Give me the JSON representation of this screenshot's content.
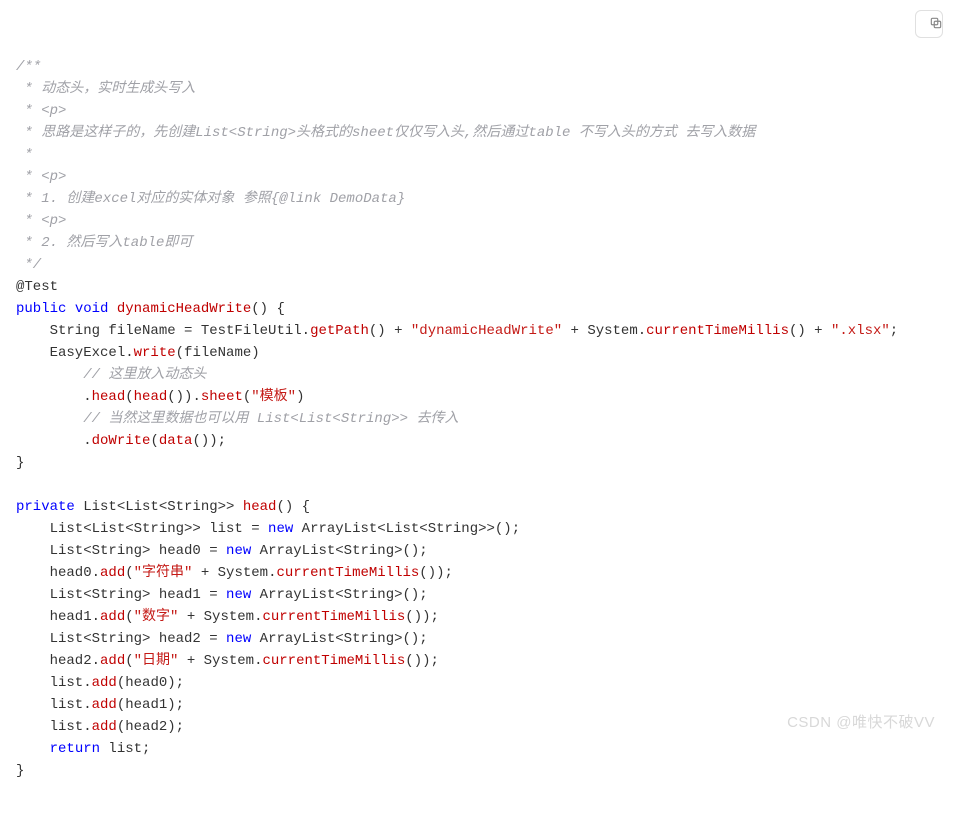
{
  "copy_button_title": "Copy",
  "watermark": "CSDN @唯快不破VV",
  "code": {
    "l01": "/**",
    "l02": " * 动态头，实时生成头写入",
    "l03": " * <p>",
    "l04": " * 思路是这样子的，先创建List<String>头格式的sheet仅仅写入头,然后通过table 不写入头的方式 去写入数据",
    "l05": " *",
    "l06": " * <p>",
    "l07": " * 1. 创建excel对应的实体对象 参照{@link DemoData}",
    "l08": " * <p>",
    "l09": " * 2. 然后写入table即可",
    "l10": " */",
    "l11": "@Test",
    "l12_public": "public",
    "l12_void": " void",
    "l12_name": " dynamicHeadWrite",
    "l12_rest": "() {",
    "l13_a": "    String fileName = TestFileUtil.",
    "l13_getPath": "getPath",
    "l13_b": "() + ",
    "l13_s1": "\"dynamicHeadWrite\"",
    "l13_c": " + System.",
    "l13_ctm": "currentTimeMillis",
    "l13_d": "() + ",
    "l13_s2": "\".xlsx\"",
    "l13_e": ";",
    "l14_a": "    EasyExcel.",
    "l14_write": "write",
    "l14_b": "(fileName)",
    "l15": "        // 这里放入动态头",
    "l16_a": "        .",
    "l16_head": "head",
    "l16_b": "(",
    "l16_headcall": "head",
    "l16_c": "()).",
    "l16_sheet": "sheet",
    "l16_d": "(",
    "l16_s": "\"模板\"",
    "l16_e": ")",
    "l17": "        // 当然这里数据也可以用 List<List<String>> 去传入",
    "l18_a": "        .",
    "l18_doWrite": "doWrite",
    "l18_b": "(",
    "l18_data": "data",
    "l18_c": "());",
    "l19": "}",
    "l20": "",
    "l21_private": "private",
    "l21_type": " List<List<String>>",
    "l21_name": " head",
    "l21_rest": "() {",
    "l22_a": "    List<List<String>> list = ",
    "l22_new": "new",
    "l22_b": " ArrayList<List<String>>();",
    "l23_a": "    List<String> head0 = ",
    "l23_new": "new",
    "l23_b": " ArrayList<String>();",
    "l24_a": "    head0.",
    "l24_add": "add",
    "l24_b": "(",
    "l24_s": "\"字符串\"",
    "l24_c": " + System.",
    "l24_ctm": "currentTimeMillis",
    "l24_d": "());",
    "l25_a": "    List<String> head1 = ",
    "l25_new": "new",
    "l25_b": " ArrayList<String>();",
    "l26_a": "    head1.",
    "l26_add": "add",
    "l26_b": "(",
    "l26_s": "\"数字\"",
    "l26_c": " + System.",
    "l26_ctm": "currentTimeMillis",
    "l26_d": "());",
    "l27_a": "    List<String> head2 = ",
    "l27_new": "new",
    "l27_b": " ArrayList<String>();",
    "l28_a": "    head2.",
    "l28_add": "add",
    "l28_b": "(",
    "l28_s": "\"日期\"",
    "l28_c": " + System.",
    "l28_ctm": "currentTimeMillis",
    "l28_d": "());",
    "l29_a": "    list.",
    "l29_add": "add",
    "l29_b": "(head0);",
    "l30_a": "    list.",
    "l30_add": "add",
    "l30_b": "(head1);",
    "l31_a": "    list.",
    "l31_add": "add",
    "l31_b": "(head2);",
    "l32_a": "    ",
    "l32_return": "return",
    "l32_b": " list;",
    "l33": "}"
  }
}
